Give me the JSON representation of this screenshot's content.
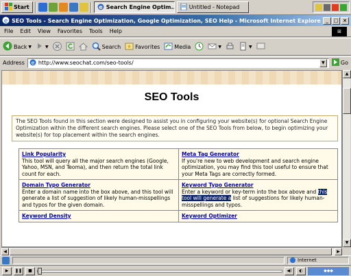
{
  "taskbar": {
    "start_label": "Start",
    "tasks": [
      {
        "label": "Search Engine Optim...",
        "active": true
      },
      {
        "label": "Untitled - Notepad",
        "active": false
      }
    ]
  },
  "window": {
    "title": "SEO Tools - Search Engine Optimization, Google Optimization, SEO Help - Microsoft Internet Explorer",
    "minimize": "_",
    "maximize": "□",
    "close": "×"
  },
  "menu": {
    "items": [
      "File",
      "Edit",
      "View",
      "Favorites",
      "Tools",
      "Help"
    ]
  },
  "toolbar": {
    "back": "Back",
    "search": "Search",
    "favorites": "Favorites",
    "media": "Media"
  },
  "address": {
    "label": "Address",
    "url": "http://www.seochat.com/seo-tools/",
    "go": "Go"
  },
  "page": {
    "title": "SEO Tools",
    "intro": "The SEO Tools found in this section were designed to assist you in configuring your website(s) for optional Search Engine Optimization within the different search engines. Please select one of the SEO Tools from below, to begin optimizing your website(s) for top placement within the search engines.",
    "tools": [
      {
        "name": "Link Popularity",
        "desc": "This tool will query all the major search engines (Google, Yahoo, MSN, and Teoma), and then return the total link count for each."
      },
      {
        "name": "Meta Tag Generator",
        "desc": "If you're new to web development and search engine optimization, you may find this tool useful to ensure that your Meta Tags are correctly formed."
      },
      {
        "name": "Domain Typo Generator",
        "desc": "Enter a domain name into the box above, and this tool will generate a list of suggestion of likely human-misspellings and typos for the given domain."
      },
      {
        "name": "Keyword Typo Generator",
        "desc_before": "Enter a keyword or key-term into the box above and ",
        "desc_highlight": "this tool will generate a",
        "desc_after": " list of suggestions for likely human-misspellings and typos."
      },
      {
        "name": "Keyword Density",
        "desc": ""
      },
      {
        "name": "Keyword Optimizer",
        "desc": ""
      }
    ]
  },
  "status": {
    "zone": "Internet"
  },
  "colors": {
    "titlebar_start": "#0a246a",
    "link": "#0000aa",
    "highlight": "#0a246a"
  }
}
